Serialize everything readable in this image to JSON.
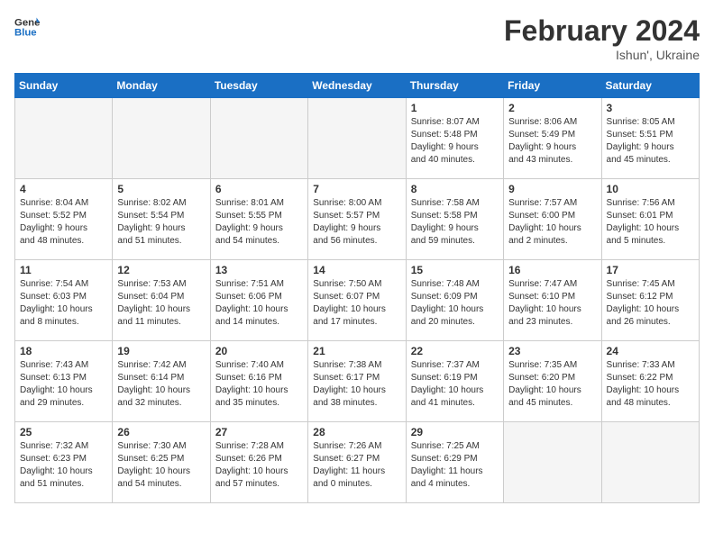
{
  "header": {
    "logo_line1": "General",
    "logo_line2": "Blue",
    "title": "February 2024",
    "subtitle": "Ishun', Ukraine"
  },
  "days_of_week": [
    "Sunday",
    "Monday",
    "Tuesday",
    "Wednesday",
    "Thursday",
    "Friday",
    "Saturday"
  ],
  "weeks": [
    [
      {
        "num": "",
        "info": ""
      },
      {
        "num": "",
        "info": ""
      },
      {
        "num": "",
        "info": ""
      },
      {
        "num": "",
        "info": ""
      },
      {
        "num": "1",
        "info": "Sunrise: 8:07 AM\nSunset: 5:48 PM\nDaylight: 9 hours\nand 40 minutes."
      },
      {
        "num": "2",
        "info": "Sunrise: 8:06 AM\nSunset: 5:49 PM\nDaylight: 9 hours\nand 43 minutes."
      },
      {
        "num": "3",
        "info": "Sunrise: 8:05 AM\nSunset: 5:51 PM\nDaylight: 9 hours\nand 45 minutes."
      }
    ],
    [
      {
        "num": "4",
        "info": "Sunrise: 8:04 AM\nSunset: 5:52 PM\nDaylight: 9 hours\nand 48 minutes."
      },
      {
        "num": "5",
        "info": "Sunrise: 8:02 AM\nSunset: 5:54 PM\nDaylight: 9 hours\nand 51 minutes."
      },
      {
        "num": "6",
        "info": "Sunrise: 8:01 AM\nSunset: 5:55 PM\nDaylight: 9 hours\nand 54 minutes."
      },
      {
        "num": "7",
        "info": "Sunrise: 8:00 AM\nSunset: 5:57 PM\nDaylight: 9 hours\nand 56 minutes."
      },
      {
        "num": "8",
        "info": "Sunrise: 7:58 AM\nSunset: 5:58 PM\nDaylight: 9 hours\nand 59 minutes."
      },
      {
        "num": "9",
        "info": "Sunrise: 7:57 AM\nSunset: 6:00 PM\nDaylight: 10 hours\nand 2 minutes."
      },
      {
        "num": "10",
        "info": "Sunrise: 7:56 AM\nSunset: 6:01 PM\nDaylight: 10 hours\nand 5 minutes."
      }
    ],
    [
      {
        "num": "11",
        "info": "Sunrise: 7:54 AM\nSunset: 6:03 PM\nDaylight: 10 hours\nand 8 minutes."
      },
      {
        "num": "12",
        "info": "Sunrise: 7:53 AM\nSunset: 6:04 PM\nDaylight: 10 hours\nand 11 minutes."
      },
      {
        "num": "13",
        "info": "Sunrise: 7:51 AM\nSunset: 6:06 PM\nDaylight: 10 hours\nand 14 minutes."
      },
      {
        "num": "14",
        "info": "Sunrise: 7:50 AM\nSunset: 6:07 PM\nDaylight: 10 hours\nand 17 minutes."
      },
      {
        "num": "15",
        "info": "Sunrise: 7:48 AM\nSunset: 6:09 PM\nDaylight: 10 hours\nand 20 minutes."
      },
      {
        "num": "16",
        "info": "Sunrise: 7:47 AM\nSunset: 6:10 PM\nDaylight: 10 hours\nand 23 minutes."
      },
      {
        "num": "17",
        "info": "Sunrise: 7:45 AM\nSunset: 6:12 PM\nDaylight: 10 hours\nand 26 minutes."
      }
    ],
    [
      {
        "num": "18",
        "info": "Sunrise: 7:43 AM\nSunset: 6:13 PM\nDaylight: 10 hours\nand 29 minutes."
      },
      {
        "num": "19",
        "info": "Sunrise: 7:42 AM\nSunset: 6:14 PM\nDaylight: 10 hours\nand 32 minutes."
      },
      {
        "num": "20",
        "info": "Sunrise: 7:40 AM\nSunset: 6:16 PM\nDaylight: 10 hours\nand 35 minutes."
      },
      {
        "num": "21",
        "info": "Sunrise: 7:38 AM\nSunset: 6:17 PM\nDaylight: 10 hours\nand 38 minutes."
      },
      {
        "num": "22",
        "info": "Sunrise: 7:37 AM\nSunset: 6:19 PM\nDaylight: 10 hours\nand 41 minutes."
      },
      {
        "num": "23",
        "info": "Sunrise: 7:35 AM\nSunset: 6:20 PM\nDaylight: 10 hours\nand 45 minutes."
      },
      {
        "num": "24",
        "info": "Sunrise: 7:33 AM\nSunset: 6:22 PM\nDaylight: 10 hours\nand 48 minutes."
      }
    ],
    [
      {
        "num": "25",
        "info": "Sunrise: 7:32 AM\nSunset: 6:23 PM\nDaylight: 10 hours\nand 51 minutes."
      },
      {
        "num": "26",
        "info": "Sunrise: 7:30 AM\nSunset: 6:25 PM\nDaylight: 10 hours\nand 54 minutes."
      },
      {
        "num": "27",
        "info": "Sunrise: 7:28 AM\nSunset: 6:26 PM\nDaylight: 10 hours\nand 57 minutes."
      },
      {
        "num": "28",
        "info": "Sunrise: 7:26 AM\nSunset: 6:27 PM\nDaylight: 11 hours\nand 0 minutes."
      },
      {
        "num": "29",
        "info": "Sunrise: 7:25 AM\nSunset: 6:29 PM\nDaylight: 11 hours\nand 4 minutes."
      },
      {
        "num": "",
        "info": ""
      },
      {
        "num": "",
        "info": ""
      }
    ]
  ]
}
